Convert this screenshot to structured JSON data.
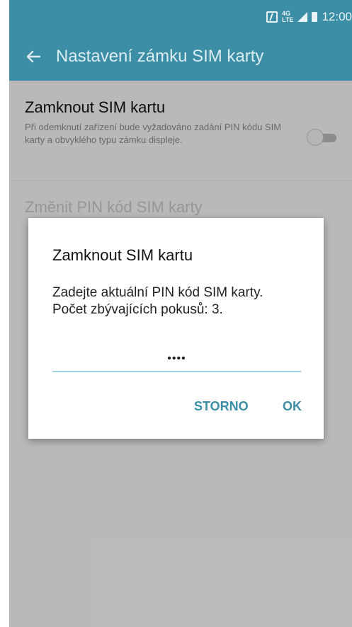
{
  "status_bar": {
    "lte": "4G LTE",
    "time": "12:00"
  },
  "app_bar": {
    "title": "Nastavení zámku SIM karty"
  },
  "settings": {
    "lock_sim": {
      "title": "Zamknout SIM kartu",
      "description": "Při odemknutí zařízení bude vyžadováno zadání PIN kódu SIM karty a obvyklého typu zámku displeje.",
      "toggle_on": false
    },
    "change_pin": {
      "title": "Změnit PIN kód SIM karty"
    }
  },
  "dialog": {
    "title": "Zamknout SIM kartu",
    "message_line1": "Zadejte aktuální PIN kód SIM karty.",
    "message_line2": "Počet zbývajících pokusů: 3.",
    "pin_value": "••••",
    "cancel_label": "STORNO",
    "ok_label": "OK"
  },
  "colors": {
    "accent": "#3b8ea5",
    "input_underline": "#9fd4e4"
  }
}
